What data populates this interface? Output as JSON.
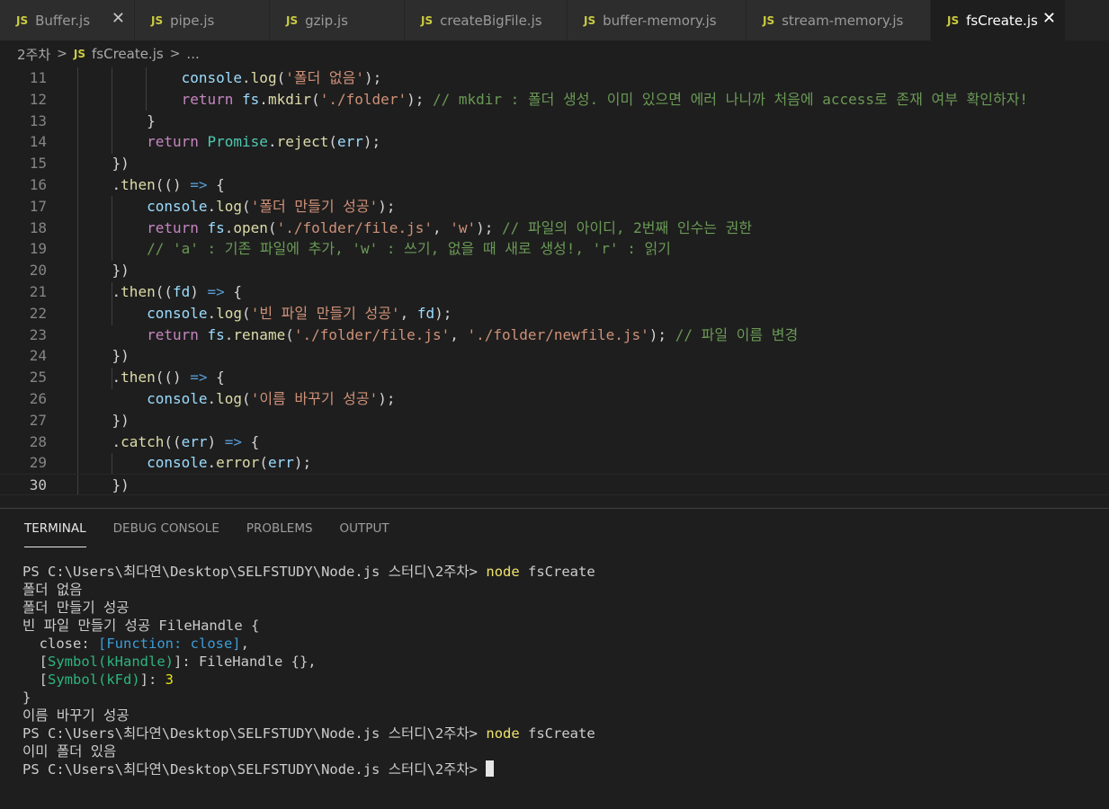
{
  "tabs": [
    {
      "badge": "JS",
      "label": "Buffer.js",
      "close": "✕"
    },
    {
      "badge": "JS",
      "label": "pipe.js"
    },
    {
      "badge": "JS",
      "label": "gzip.js"
    },
    {
      "badge": "JS",
      "label": "createBigFile.js"
    },
    {
      "badge": "JS",
      "label": "buffer-memory.js"
    },
    {
      "badge": "JS",
      "label": "stream-memory.js"
    },
    {
      "badge": "JS",
      "label": "fsCreate.js",
      "close": "✕"
    }
  ],
  "breadcrumb": {
    "folder": "2주차",
    "sep": ">",
    "badge": "JS",
    "file": "fsCreate.js",
    "sep2": ">",
    "more": "..."
  },
  "editor": {
    "line_numbers": [
      "11",
      "12",
      "13",
      "14",
      "15",
      "16",
      "17",
      "18",
      "19",
      "20",
      "21",
      "22",
      "23",
      "24",
      "25",
      "26",
      "27",
      "28",
      "29",
      "30"
    ],
    "lines": [
      [
        [
          "            ",
          "pl"
        ],
        [
          "console",
          "id"
        ],
        [
          ".",
          "pl"
        ],
        [
          "log",
          "fn"
        ],
        [
          "(",
          "pl"
        ],
        [
          "'폴더 없음'",
          "str"
        ],
        [
          ");",
          "pl"
        ]
      ],
      [
        [
          "            ",
          "pl"
        ],
        [
          "return",
          "kw"
        ],
        [
          " ",
          "pl"
        ],
        [
          "fs",
          "id"
        ],
        [
          ".",
          "pl"
        ],
        [
          "mkdir",
          "fn"
        ],
        [
          "(",
          "pl"
        ],
        [
          "'./folder'",
          "str"
        ],
        [
          "); ",
          "pl"
        ],
        [
          "// mkdir : 폴더 생성. 이미 있으면 에러 나니까 처음에 access로 존재 여부 확인하자!",
          "cm"
        ]
      ],
      [
        [
          "        }",
          "pl"
        ]
      ],
      [
        [
          "        ",
          "pl"
        ],
        [
          "return",
          "kw"
        ],
        [
          " ",
          "pl"
        ],
        [
          "Promise",
          "cls"
        ],
        [
          ".",
          "pl"
        ],
        [
          "reject",
          "fn"
        ],
        [
          "(",
          "pl"
        ],
        [
          "err",
          "id"
        ],
        [
          ");",
          "pl"
        ]
      ],
      [
        [
          "    })",
          "pl"
        ]
      ],
      [
        [
          "    .",
          "pl"
        ],
        [
          "then",
          "fn"
        ],
        [
          "(() ",
          "pl"
        ],
        [
          "=>",
          "op"
        ],
        [
          " {",
          "pl"
        ]
      ],
      [
        [
          "        ",
          "pl"
        ],
        [
          "console",
          "id"
        ],
        [
          ".",
          "pl"
        ],
        [
          "log",
          "fn"
        ],
        [
          "(",
          "pl"
        ],
        [
          "'폴더 만들기 성공'",
          "str"
        ],
        [
          ");",
          "pl"
        ]
      ],
      [
        [
          "        ",
          "pl"
        ],
        [
          "return",
          "kw"
        ],
        [
          " ",
          "pl"
        ],
        [
          "fs",
          "id"
        ],
        [
          ".",
          "pl"
        ],
        [
          "open",
          "fn"
        ],
        [
          "(",
          "pl"
        ],
        [
          "'./folder/file.js'",
          "str"
        ],
        [
          ", ",
          "pl"
        ],
        [
          "'w'",
          "str"
        ],
        [
          "); ",
          "pl"
        ],
        [
          "// 파일의 아이디, 2번째 인수는 권한",
          "cm"
        ]
      ],
      [
        [
          "        ",
          "pl"
        ],
        [
          "// 'a' : 기존 파일에 추가, 'w' : 쓰기, 없을 때 새로 생성!, 'r' : 읽기",
          "cm"
        ]
      ],
      [
        [
          "    })",
          "pl"
        ]
      ],
      [
        [
          "    .",
          "pl"
        ],
        [
          "then",
          "fn"
        ],
        [
          "((",
          "pl"
        ],
        [
          "fd",
          "id"
        ],
        [
          ") ",
          "pl"
        ],
        [
          "=>",
          "op"
        ],
        [
          " {",
          "pl"
        ]
      ],
      [
        [
          "        ",
          "pl"
        ],
        [
          "console",
          "id"
        ],
        [
          ".",
          "pl"
        ],
        [
          "log",
          "fn"
        ],
        [
          "(",
          "pl"
        ],
        [
          "'빈 파일 만들기 성공'",
          "str"
        ],
        [
          ", ",
          "pl"
        ],
        [
          "fd",
          "id"
        ],
        [
          ");",
          "pl"
        ]
      ],
      [
        [
          "        ",
          "pl"
        ],
        [
          "return",
          "kw"
        ],
        [
          " ",
          "pl"
        ],
        [
          "fs",
          "id"
        ],
        [
          ".",
          "pl"
        ],
        [
          "rename",
          "fn"
        ],
        [
          "(",
          "pl"
        ],
        [
          "'./folder/file.js'",
          "str"
        ],
        [
          ", ",
          "pl"
        ],
        [
          "'./folder/newfile.js'",
          "str"
        ],
        [
          "); ",
          "pl"
        ],
        [
          "// 파일 이름 변경",
          "cm"
        ]
      ],
      [
        [
          "    })",
          "pl"
        ]
      ],
      [
        [
          "    .",
          "pl"
        ],
        [
          "then",
          "fn"
        ],
        [
          "(() ",
          "pl"
        ],
        [
          "=>",
          "op"
        ],
        [
          " {",
          "pl"
        ]
      ],
      [
        [
          "        ",
          "pl"
        ],
        [
          "console",
          "id"
        ],
        [
          ".",
          "pl"
        ],
        [
          "log",
          "fn"
        ],
        [
          "(",
          "pl"
        ],
        [
          "'이름 바꾸기 성공'",
          "str"
        ],
        [
          ");",
          "pl"
        ]
      ],
      [
        [
          "    })",
          "pl"
        ]
      ],
      [
        [
          "    .",
          "pl"
        ],
        [
          "catch",
          "fn"
        ],
        [
          "((",
          "pl"
        ],
        [
          "err",
          "id"
        ],
        [
          ") ",
          "pl"
        ],
        [
          "=>",
          "op"
        ],
        [
          " {",
          "pl"
        ]
      ],
      [
        [
          "        ",
          "pl"
        ],
        [
          "console",
          "id"
        ],
        [
          ".",
          "pl"
        ],
        [
          "error",
          "fn"
        ],
        [
          "(",
          "pl"
        ],
        [
          "err",
          "id"
        ],
        [
          ");",
          "pl"
        ]
      ],
      [
        [
          "    })",
          "pl"
        ]
      ]
    ]
  },
  "panel": {
    "tabs": [
      "TERMINAL",
      "DEBUG CONSOLE",
      "PROBLEMS",
      "OUTPUT"
    ],
    "terminal": [
      [
        [
          "PS C:\\Users\\최다연\\Desktop\\SELFSTUDY\\Node.js 스터디\\2주차> ",
          ""
        ],
        [
          "node",
          "t-cmd"
        ],
        [
          " fsCreate",
          ""
        ]
      ],
      [
        [
          "폴더 없음",
          ""
        ]
      ],
      [
        [
          "폴더 만들기 성공",
          ""
        ]
      ],
      [
        [
          "빈 파일 만들기 성공 FileHandle {",
          ""
        ]
      ],
      [
        [
          "  close: ",
          ""
        ],
        [
          "[Function: close]",
          "t-cyan"
        ],
        [
          ",",
          ""
        ]
      ],
      [
        [
          "  [",
          ""
        ],
        [
          "Symbol(kHandle)",
          "t-green"
        ],
        [
          "]: FileHandle {},",
          ""
        ]
      ],
      [
        [
          "  [",
          ""
        ],
        [
          "Symbol(kFd)",
          "t-green"
        ],
        [
          "]: ",
          ""
        ],
        [
          "3",
          "t-yellow"
        ]
      ],
      [
        [
          "}",
          ""
        ]
      ],
      [
        [
          "이름 바꾸기 성공",
          ""
        ]
      ],
      [
        [
          "PS C:\\Users\\최다연\\Desktop\\SELFSTUDY\\Node.js 스터디\\2주차> ",
          ""
        ],
        [
          "node",
          "t-cmd"
        ],
        [
          " fsCreate",
          ""
        ]
      ],
      [
        [
          "이미 폴더 있음",
          ""
        ]
      ],
      [
        [
          "PS C:\\Users\\최다연\\Desktop\\SELFSTUDY\\Node.js 스터디\\2주차> ",
          ""
        ]
      ]
    ]
  },
  "colors": {
    "js_badge": "#cbcb41",
    "background": "#1e1e1e",
    "tab_inactive": "#2d2d2d"
  },
  "icons": {
    "tab_icon": "js-file-icon",
    "close": "close-icon"
  }
}
